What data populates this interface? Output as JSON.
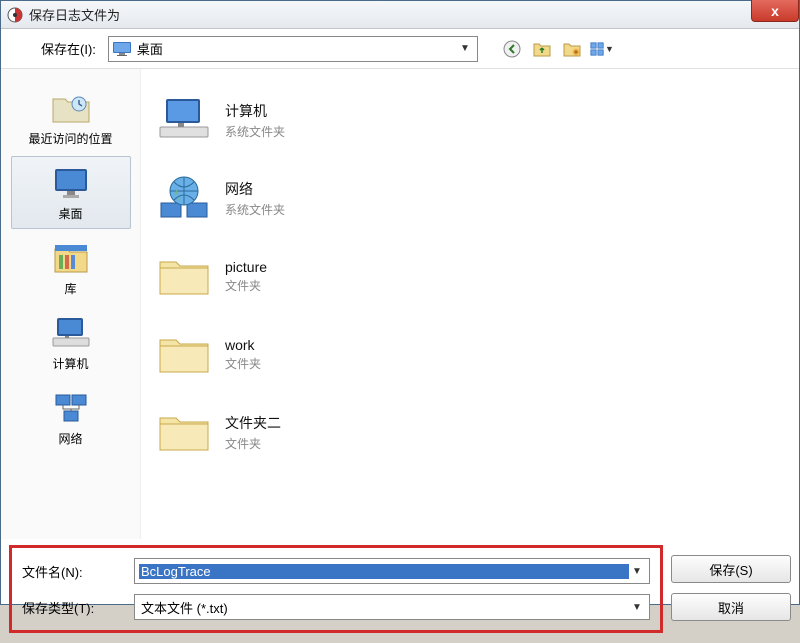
{
  "title": "保存日志文件为",
  "close_label": "x",
  "toolbar": {
    "lookin_label": "保存在(I):",
    "lookin_value": "桌面"
  },
  "sidebar": [
    {
      "key": "recent",
      "label": "最近访问的位置",
      "selected": false
    },
    {
      "key": "desktop",
      "label": "桌面",
      "selected": true
    },
    {
      "key": "library",
      "label": "库",
      "selected": false
    },
    {
      "key": "computer",
      "label": "计算机",
      "selected": false
    },
    {
      "key": "network",
      "label": "网络",
      "selected": false
    }
  ],
  "files": [
    {
      "name": "计算机",
      "sub": "系统文件夹",
      "icon": "computer"
    },
    {
      "name": "网络",
      "sub": "系统文件夹",
      "icon": "network"
    },
    {
      "name": "picture",
      "sub": "文件夹",
      "icon": "folder"
    },
    {
      "name": "work",
      "sub": "文件夹",
      "icon": "folder"
    },
    {
      "name": "文件夹二",
      "sub": "文件夹",
      "icon": "folder"
    }
  ],
  "inputs": {
    "filename_label": "文件名(N):",
    "filename_value": "BcLogTrace",
    "filetype_label": "保存类型(T):",
    "filetype_value": "文本文件 (*.txt)"
  },
  "buttons": {
    "save": "保存(S)",
    "cancel": "取消"
  }
}
